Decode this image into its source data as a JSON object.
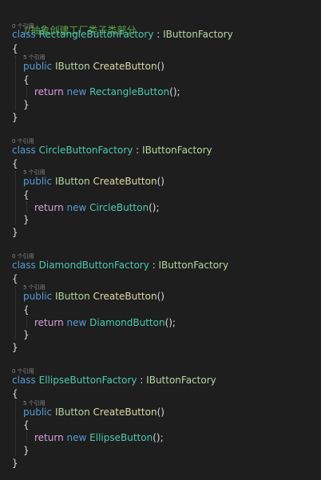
{
  "comment": "//抽象创建工厂类子类部分",
  "reference_hint_class": "0 个引用",
  "reference_hint_method": "5 个引用",
  "kw_class": "class",
  "kw_public": "public",
  "kw_return": "return",
  "kw_new": "new",
  "colon": " : ",
  "interface": "IButtonFactory",
  "return_type": "IButton",
  "method_name": "CreateButton",
  "method_parens": "()",
  "call_end": "();",
  "open_brace": "{",
  "close_brace": "}",
  "factories": [
    {
      "name": "RectangleButtonFactory",
      "product": "RectangleButton"
    },
    {
      "name": "CircleButtonFactory",
      "product": "CircleButton"
    },
    {
      "name": "DiamondButtonFactory",
      "product": "DiamondButton"
    },
    {
      "name": "EllipseButtonFactory",
      "product": "EllipseButton"
    }
  ],
  "colors": {
    "background": "#1e1e1e",
    "keyword": "#569cd6",
    "control_keyword": "#d8a0df",
    "type": "#4ec9b0",
    "interface": "#b8d7a3",
    "method": "#dcdcaa",
    "comment": "#57a64a",
    "text": "#dcdcdc",
    "codelens": "#8a8a8a"
  }
}
